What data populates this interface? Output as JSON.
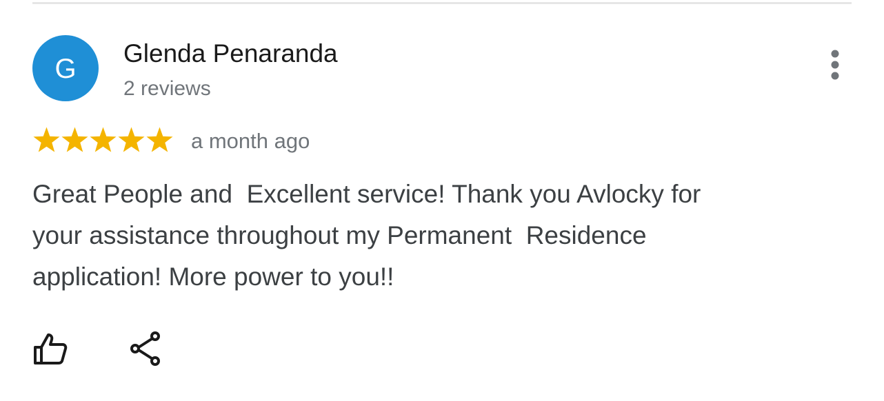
{
  "review": {
    "avatar_letter": "G",
    "reviewer_name": "Glenda Penaranda",
    "reviewer_reviews": "2 reviews",
    "rating": 5,
    "rating_max": 5,
    "date": "a month ago",
    "text": "Great People and  Excellent service! Thank you Avlocky for\nyour assistance throughout my Permanent  Residence\napplication! More power to you!!"
  },
  "colors": {
    "avatar": "#1f8fd6",
    "star": "#f4b400",
    "secondary_text": "#70757a",
    "body_text": "#3c4043"
  },
  "icons": {
    "more": "more-vert-icon",
    "star": "star-icon",
    "like": "thumb-up-icon",
    "share": "share-icon"
  }
}
